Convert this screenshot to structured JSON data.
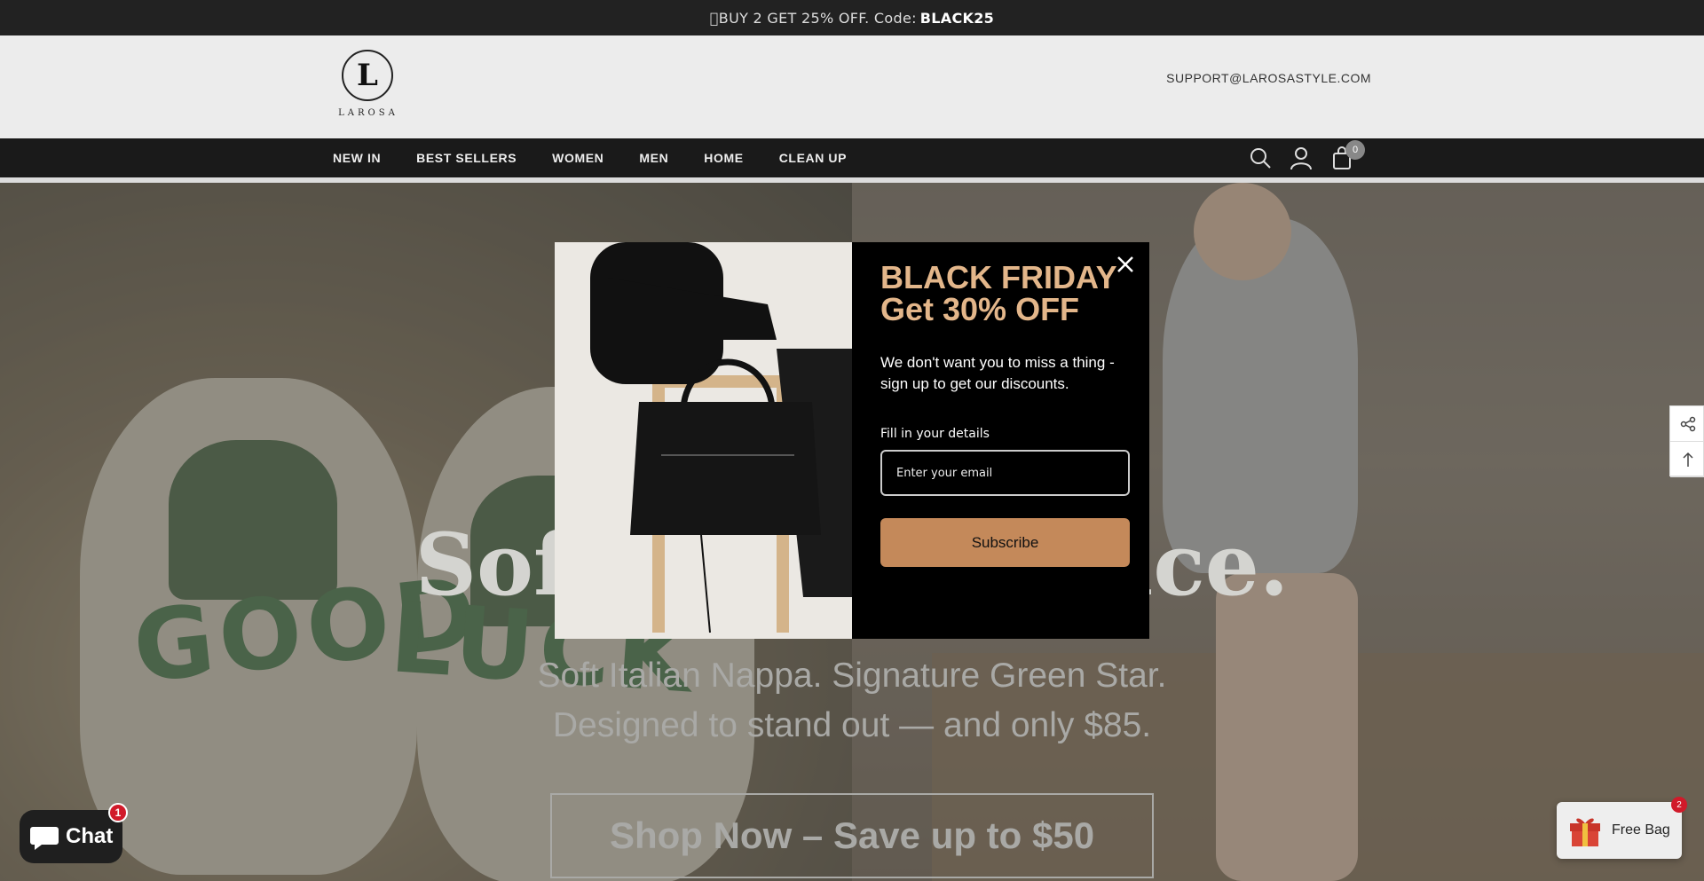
{
  "announcement": {
    "text": "\u0000BUY 2 GET 25% OFF. Code:",
    "code": "BLACK25"
  },
  "header": {
    "logo_letter": "L",
    "logo_text": "LAROSA",
    "support_email": "SUPPORT@LAROSASTYLE.COM"
  },
  "nav": {
    "items": [
      {
        "label": "NEW IN"
      },
      {
        "label": "BEST SELLERS"
      },
      {
        "label": "WOMEN"
      },
      {
        "label": "MEN"
      },
      {
        "label": "HOME"
      },
      {
        "label": "CLEAN UP"
      }
    ],
    "icons": [
      "search-icon",
      "account-icon",
      "cart-icon"
    ],
    "cart_count": "0"
  },
  "hero": {
    "title": "Soft Price.",
    "subtitle_line1": "Soft Italian Nappa. Signature Green Star.",
    "subtitle_line2": "Designed to stand out — and only $85.",
    "cta": "Shop Now – Save up to $50",
    "shoe_word_left": "GOOD",
    "shoe_word_right": "LUCK"
  },
  "popup": {
    "title_line1": "BLACK FRIDAY",
    "title_line2": "Get 30% OFF",
    "description": "We don't want you to miss a thing - sign up to get our discounts.",
    "label": "Fill in your details",
    "email_placeholder": "Enter your email",
    "button": "Subscribe",
    "accent_color": "#e3b68a",
    "button_color": "#c4895a"
  },
  "side_tools": [
    "share-icon",
    "back-to-top-icon"
  ],
  "chat": {
    "label": "Chat",
    "badge": "1"
  },
  "free_bag": {
    "label": "Free Bag",
    "badge": "2"
  }
}
